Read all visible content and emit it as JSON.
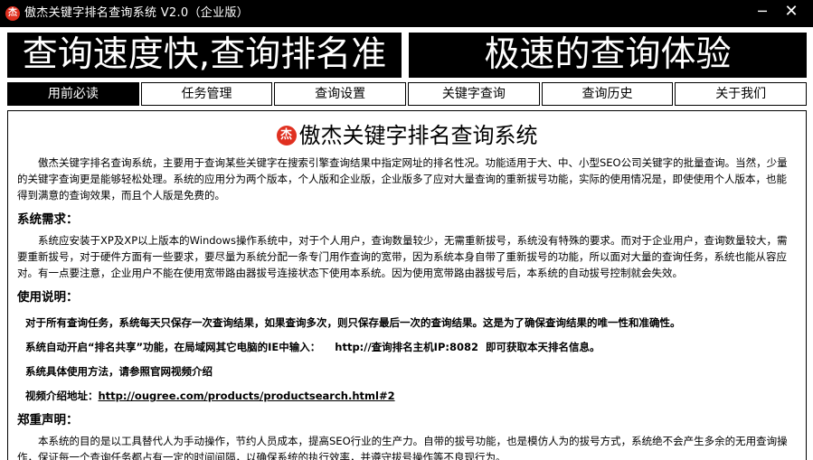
{
  "window": {
    "title": "傲杰关键字排名查询系统 V2.0（企业版）",
    "icon_text": "杰",
    "minimize_glyph": "─",
    "close_glyph": "✕"
  },
  "banners": {
    "left": "查询速度快,查询排名准",
    "right": "极速的查询体验"
  },
  "tabs": [
    {
      "label": "用前必读",
      "active": true
    },
    {
      "label": "任务管理",
      "active": false
    },
    {
      "label": "查询设置",
      "active": false
    },
    {
      "label": "关键字查询",
      "active": false
    },
    {
      "label": "查询历史",
      "active": false
    },
    {
      "label": "关于我们",
      "active": false
    }
  ],
  "content": {
    "logo_text": "杰",
    "title": "傲杰关键字排名查询系统",
    "intro": "傲杰关键字排名查询系统，主要用于查询某些关键字在搜索引擎查询结果中指定网址的排名性况。功能适用于大、中、小型SEO公司关键字的批量查询。当然，少量的关键字查询更是能够轻松处理。系统的应用分为两个版本，个人版和企业版，企业版多了应对大量查询的重新拔号功能，实际的使用情况是，即使使用个人版本，也能得到满意的查询效果，而且个人版是免费的。",
    "req_heading": "系统需求：",
    "req_text": "系统应安装于XP及XP以上版本的Windows操作系统中，对于个人用户，查询数量较少，无需重新拔号，系统没有特殊的要求。而对于企业用户，查询数量较大，需要重新拔号，对于硬件方面有一些要求，要尽量为系统分配一条专门用作查询的宽带，因为系统本身自带了重新拔号的功能，所以面对大量的查询任务，系统也能从容应对。有一点要注意，企业用户不能在使用宽带路由器拔号连接状态下使用本系统。因为使用宽带路由器拔号后，本系统的自动拔号控制就会失效。",
    "usage_heading": "使用说明：",
    "usage_1": "对于所有查询任务，系统每天只保存一次查询结果，如果查询多次，则只保存最后一次的查询结果。这是为了确保查询结果的唯一性和准确性。",
    "usage_2": "系统自动开启“排名共享”功能，在局域网其它电脑的IE中输入：    http://查询排名主机IP:8082  即可获取本天排名信息。",
    "usage_3": "系统具体使用方法，请参照官网视频介绍",
    "video_label": "视频介绍地址：",
    "video_link": "http://ougree.com/products/productsearch.html#2",
    "notice_heading": "郑重声明：",
    "notice_text": "本系统的目的是以工具替代人为手动操作，节约人员成本，提高SEO行业的生产力。自带的拔号功能，也是模仿人为的拔号方式，系统绝不会产生多余的无用查询操作，保证每一个查询任务都占有一定的时间间隔，以确保系统的执行效率，并遵守拔号操作等不良现行为。"
  }
}
